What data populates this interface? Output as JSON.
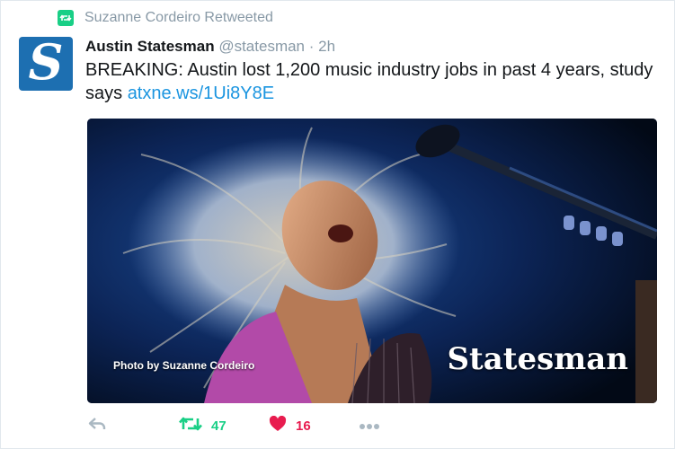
{
  "retweet_context": {
    "text": "Suzanne Cordeiro Retweeted",
    "icon": "retweet-icon",
    "color": "#19cf86"
  },
  "author": {
    "name": "Austin Statesman",
    "handle": "@statesman",
    "separator": "·",
    "time": "2h",
    "avatar_letter": "S",
    "avatar_color": "#1d6fb1"
  },
  "tweet": {
    "text": "BREAKING: Austin lost 1,200 music industry jobs in past 4 years, study says",
    "link": "atxne.ws/1Ui8Y8E"
  },
  "media": {
    "photo_credit": "Photo by Suzanne Cordeiro",
    "watermark": "Statesman"
  },
  "actions": {
    "reply_icon": "reply-icon",
    "retweet_icon": "retweet-icon",
    "retweet_count": "47",
    "like_icon": "heart-icon",
    "like_count": "16",
    "more_icon": "more-icon",
    "retweet_color": "#19cf86",
    "like_color": "#e81c4f"
  }
}
